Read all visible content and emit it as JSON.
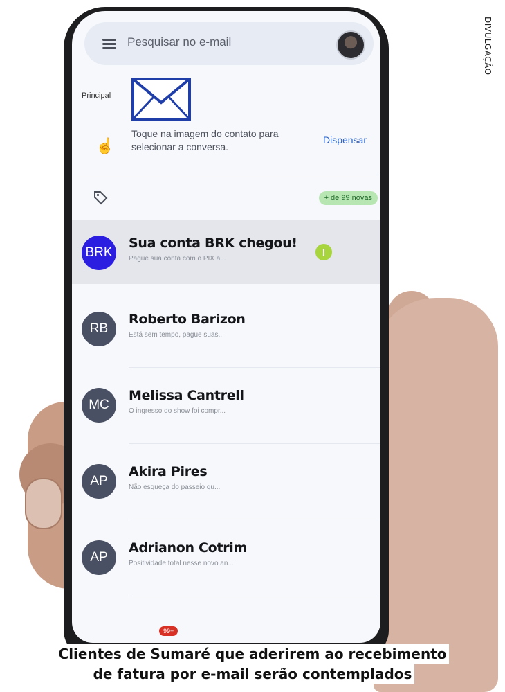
{
  "credit": "DIVULGAÇÃO",
  "search": {
    "placeholder": "Pesquisar no e-mail"
  },
  "section": {
    "label": "Principal"
  },
  "hint": {
    "text": "Toque na imagem do contato para selecionar a conversa.",
    "dismiss": "Dispensar"
  },
  "badge": {
    "new_count": "+ de 99 novas"
  },
  "emails": [
    {
      "initials": "BRK",
      "sender": "Sua conta BRK chegou!",
      "snippet": "Pague sua conta com o PIX a...",
      "avatar_color": "#2b1ee0",
      "highlighted": true,
      "warning": "!"
    },
    {
      "initials": "RB",
      "sender": "Roberto Barizon",
      "snippet": "Está sem tempo, pague suas...",
      "avatar_color": "#4a5063"
    },
    {
      "initials": "MC",
      "sender": "Melissa Cantrell",
      "snippet": "O ingresso do show foi compr...",
      "avatar_color": "#4a5063"
    },
    {
      "initials": "AP",
      "sender": "Akira Pires",
      "snippet": "Não esqueça do passeio qu...",
      "avatar_color": "#4a5063"
    },
    {
      "initials": "AP",
      "sender": "Adrianon Cotrim",
      "snippet": "Positividade total nesse novo an...",
      "avatar_color": "#4a5063"
    }
  ],
  "bottom_badge": "99+",
  "caption": {
    "line1": "Clientes de Sumaré que aderirem ao recebimento",
    "line2": "de fatura por e-mail serão contemplados"
  }
}
